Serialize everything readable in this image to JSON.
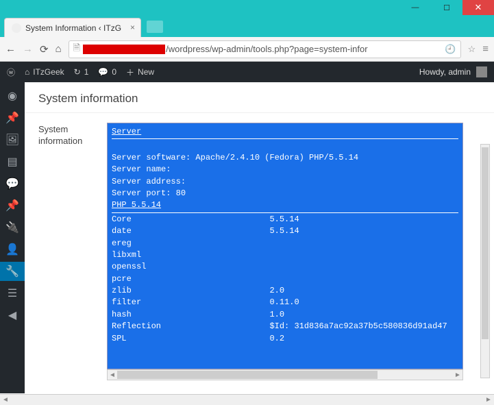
{
  "window": {
    "tab_title": "System Information ‹ ITzG",
    "url_visible": "/wordpress/wp-admin/tools.php?page=system-infor"
  },
  "wp_adminbar": {
    "site_name": "ITzGeek",
    "updates_count": "1",
    "comments_count": "0",
    "new_label": "New",
    "howdy": "Howdy, admin"
  },
  "page": {
    "title": "System information",
    "section_label": "System information"
  },
  "sysinfo": {
    "section_server": "Server",
    "server_lines": [
      "Server software: Apache/2.4.10 (Fedora) PHP/5.5.14",
      "Server name:",
      "Server address:",
      "Server port: 80"
    ],
    "php_header": "PHP 5.5.14",
    "modules": [
      {
        "name": "Core",
        "val": "5.5.14"
      },
      {
        "name": "date",
        "val": "5.5.14"
      },
      {
        "name": "ereg",
        "val": ""
      },
      {
        "name": "libxml",
        "val": ""
      },
      {
        "name": "openssl",
        "val": ""
      },
      {
        "name": "pcre",
        "val": ""
      },
      {
        "name": "zlib",
        "val": "2.0"
      },
      {
        "name": "filter",
        "val": "0.11.0"
      },
      {
        "name": "hash",
        "val": "1.0"
      },
      {
        "name": "Reflection",
        "val": "$Id: 31d836a7ac92a37b5c580836d91ad47"
      },
      {
        "name": "SPL",
        "val": "0.2"
      }
    ]
  },
  "icons": {
    "wp_logo": "ⓦ",
    "home": "⌂",
    "updates": "↻",
    "comment": "💬",
    "plus": "＋",
    "side_dashboard": "◉",
    "side_pin": "📌",
    "side_media": "🖼",
    "side_pages": "▤",
    "side_comments": "💬",
    "side_pin2": "📌",
    "side_plugins": "🔌",
    "side_users": "👤",
    "side_tools": "🔧",
    "side_settings": "☰",
    "side_collapse": "◀"
  }
}
